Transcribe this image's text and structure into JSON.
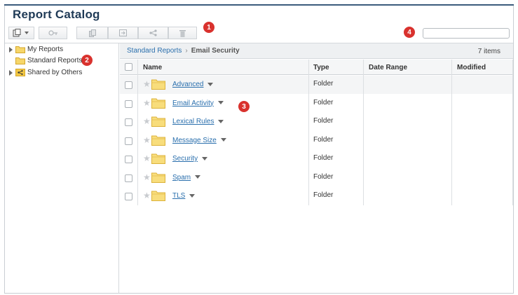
{
  "page": {
    "title": "Report Catalog"
  },
  "toolbar": {
    "buttons": [
      {
        "icon": "new-report-icon",
        "has_dropdown": true,
        "enabled": true
      },
      {
        "icon": "schedule-key-icon",
        "enabled": false
      },
      {
        "icon": "copy-icon",
        "enabled": false
      },
      {
        "icon": "move-icon",
        "enabled": false
      },
      {
        "icon": "share-icon",
        "enabled": false
      },
      {
        "icon": "delete-icon",
        "enabled": false
      }
    ]
  },
  "callouts": [
    "1",
    "2",
    "3",
    "4"
  ],
  "search": {
    "value": "",
    "placeholder": ""
  },
  "sidebar": {
    "items": [
      {
        "label": "My Reports",
        "expandable": true,
        "icon": "folder-icon"
      },
      {
        "label": "Standard Reports",
        "expandable": false,
        "icon": "folder-icon",
        "selected": true
      },
      {
        "label": "Shared by Others",
        "expandable": true,
        "icon": "shared-folder-icon"
      }
    ]
  },
  "breadcrumb": {
    "parent": "Standard Reports",
    "separator": "›",
    "current": "Email Security"
  },
  "item_count": "7 items",
  "table": {
    "columns": [
      "Name",
      "Type",
      "Date Range",
      "Modified"
    ],
    "rows": [
      {
        "name": "Advanced",
        "type": "Folder",
        "date_range": "",
        "modified": ""
      },
      {
        "name": "Email Activity",
        "type": "Folder",
        "date_range": "",
        "modified": ""
      },
      {
        "name": "Lexical Rules",
        "type": "Folder",
        "date_range": "",
        "modified": ""
      },
      {
        "name": "Message Size",
        "type": "Folder",
        "date_range": "",
        "modified": ""
      },
      {
        "name": "Security",
        "type": "Folder",
        "date_range": "",
        "modified": ""
      },
      {
        "name": "Spam",
        "type": "Folder",
        "date_range": "",
        "modified": ""
      },
      {
        "name": "TLS",
        "type": "Folder",
        "date_range": "",
        "modified": ""
      }
    ]
  },
  "colors": {
    "title": "#1f3a56",
    "link": "#2a6fad",
    "badge": "#d9322e",
    "folder": "#f4c945"
  }
}
